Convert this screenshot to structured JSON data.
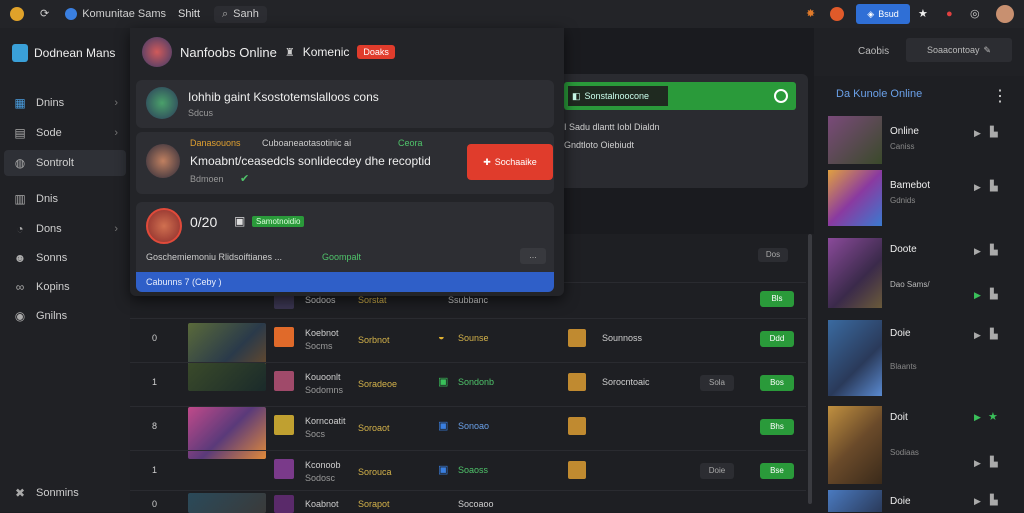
{
  "topbar": {
    "app_title": "Komunitae Sams",
    "tab": "Shitt",
    "search_label": "Sanh",
    "action_button": "Bsud"
  },
  "sidebar": {
    "app_name": "Dodnean Mans",
    "items": [
      {
        "label": "Dnins"
      },
      {
        "label": "Sode"
      },
      {
        "label": "Sontrolt"
      },
      {
        "label": "Dnis"
      },
      {
        "label": "Dons"
      },
      {
        "label": "Sonns"
      },
      {
        "label": "Kopins"
      },
      {
        "label": "Gnilns"
      }
    ],
    "footer": "Sonmins"
  },
  "overlay": {
    "title": "Nanfoobs Online",
    "subtitle": "Komenic",
    "badge": "Doaks",
    "notif1": {
      "title": "Iohhib gaint Ksostotemslalloos cons",
      "sub": "Sdcus"
    },
    "notif2": {
      "meta": "Danasouons",
      "meta2": "Cuboaneaotasotinic ai",
      "meta3": "Ceora",
      "title": "Kmoabnt/ceasedcls sonlidecdey dhe recoptid",
      "sub": "Bdmoen",
      "button": "Sochaaike"
    },
    "notif3": {
      "title": "0/20",
      "tag": "Samotnoidio",
      "text": "Goschemiemoniu Rlidsoiftianes ...",
      "text_green": "Goompalt",
      "more": "...",
      "bar_text": "Cabunns 7 (Ceby )"
    }
  },
  "main": {
    "banner": {
      "label": "Sonstalnoocone",
      "line1": "I Sadu dlantt Iobl Dialdn",
      "line2": "Gndtloto Oiebiudt"
    },
    "header_pill": "Dos",
    "rows": [
      {
        "idx": "",
        "name": "Sodoos",
        "status": "Sorstat",
        "badge": "Ssubbanc",
        "char": "",
        "action": "",
        "btn": "Bls"
      },
      {
        "idx": "0",
        "name": "Koebnot",
        "sub": "Socms",
        "status": "Sorbnot",
        "badge": "Sounse",
        "char": "Sounnoss",
        "action": "",
        "btn": "Ddd"
      },
      {
        "idx": "1",
        "name": "Kouoonlt",
        "sub": "Sodomns",
        "status": "Soradeoe",
        "badge": "Sondonb",
        "char": "Sorocntoaic",
        "action": "Sola",
        "btn": "Bos"
      },
      {
        "idx": "8",
        "name": "Korncoatit",
        "sub": "Socs",
        "status": "Soroaot",
        "badge": "Sonoao",
        "char": "",
        "action": "",
        "btn": "Bhs"
      },
      {
        "idx": "1",
        "name": "Kconoob",
        "sub": "Sodosc",
        "status": "Sorouca",
        "badge": "Soaoss",
        "char": "",
        "action": "Doie",
        "btn": "Bse"
      },
      {
        "idx": "0",
        "name": "Koabnot",
        "sub": "",
        "status": "Sorapot",
        "badge": "Socoaoo",
        "char": "",
        "action": "",
        "btn": ""
      }
    ]
  },
  "rpanel": {
    "header_left": "Caobis",
    "header_right": "Soaacontoay",
    "title": "Da Kunole Online",
    "items": [
      {
        "title": "Online",
        "sub": "Caniss"
      },
      {
        "title": "Bamebot",
        "sub": "Gdnids"
      },
      {
        "title": "Doote",
        "sub": "Dao Sams/"
      },
      {
        "title": "Doie",
        "sub": "Blaants"
      },
      {
        "title": "Doit",
        "sub": "Sodiaas"
      },
      {
        "title": "Doie",
        "sub": ""
      }
    ]
  },
  "colors": {
    "accent_blue": "#2f6fd6",
    "green": "#2a9a3a",
    "red": "#e03c2c",
    "bg": "#1c1d21"
  }
}
